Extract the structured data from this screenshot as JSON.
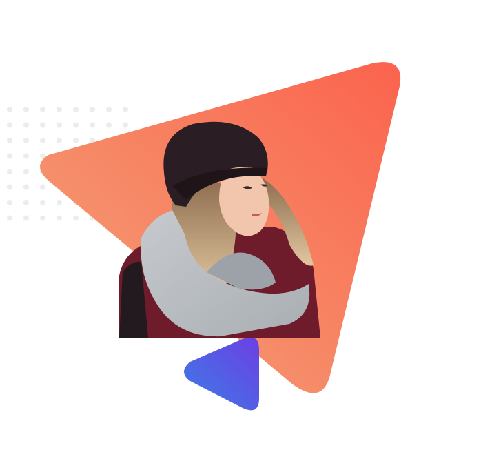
{
  "colors": {
    "background": "#ffffff",
    "dot": "#ececec",
    "big_triangle_start": "#f3a57a",
    "big_triangle_end": "#fb634d",
    "small_triangle_start": "#3c7de6",
    "small_triangle_end": "#6c3fe4",
    "photo_backdrop": "#f69a72",
    "beanie": "#2b1d24",
    "scarf": "#b9bec3",
    "coat": "#6e1c2c",
    "hair": "#d6b590",
    "skin": "#f1c6ad"
  },
  "graphics": {
    "dot_grid": "decorative-dot-pattern",
    "big_shape": "rounded-triangle",
    "small_shape": "rounded-play-triangle",
    "photo": "woman-in-beanie-and-scarf"
  }
}
